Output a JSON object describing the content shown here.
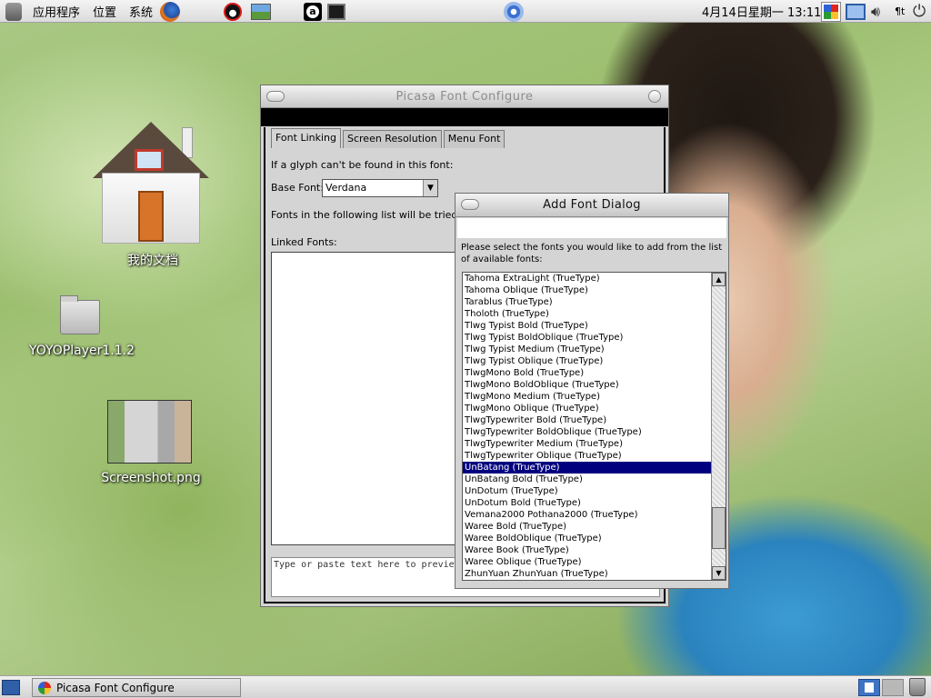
{
  "top_panel": {
    "menus": {
      "applications": "应用程序",
      "places": "位置",
      "system": "系统"
    },
    "clock": "4月14日星期一 13:11",
    "input_indicator": "¶t",
    "icons": [
      "foot-icon",
      "firefox-icon",
      "penguin-icon",
      "photo-icon",
      "a-icon",
      "terminal-icon",
      "network-icon",
      "picasa-icon",
      "monitor-icon",
      "speaker-icon",
      "power-icon"
    ]
  },
  "desktop": {
    "icons": [
      {
        "label": "我的文档",
        "icon": "home-folder-icon"
      },
      {
        "label": "YOYOPlayer1.1.2",
        "icon": "folder-icon"
      },
      {
        "label": "Screenshot.png",
        "icon": "image-thumbnail-icon"
      }
    ]
  },
  "main_window": {
    "title": "Picasa Font Configure",
    "tabs": [
      "Font Linking",
      "Screen Resolution",
      "Menu Font"
    ],
    "active_tab": "Font Linking",
    "glyph_text": "If a glyph can't be found in this font:",
    "base_font_label": "Base Font:",
    "base_font_value": "Verdana",
    "fonts_tried_text": "Fonts in the following list will be tried:",
    "linked_fonts_label": "Linked Fonts:",
    "preview_placeholder": "Type or paste text here to preview"
  },
  "add_font_dialog": {
    "title": "Add Font Dialog",
    "instructions": "Please select the fonts you would like to add from the list of available fonts:",
    "selected": "UnBatang (TrueType)",
    "fonts": [
      "Tahoma ExtraLight (TrueType)",
      "Tahoma Oblique (TrueType)",
      "Tarablus (TrueType)",
      "Tholoth (TrueType)",
      "Tlwg Typist Bold (TrueType)",
      "Tlwg Typist BoldOblique (TrueType)",
      "Tlwg Typist Medium (TrueType)",
      "Tlwg Typist Oblique (TrueType)",
      "TlwgMono Bold (TrueType)",
      "TlwgMono BoldOblique (TrueType)",
      "TlwgMono Medium (TrueType)",
      "TlwgMono Oblique (TrueType)",
      "TlwgTypewriter Bold (TrueType)",
      "TlwgTypewriter BoldOblique (TrueType)",
      "TlwgTypewriter Medium (TrueType)",
      "TlwgTypewriter Oblique (TrueType)",
      "UnBatang (TrueType)",
      "UnBatang Bold (TrueType)",
      "UnDotum (TrueType)",
      "UnDotum Bold (TrueType)",
      "Vemana2000 Pothana2000 (TrueType)",
      "Waree Bold (TrueType)",
      "Waree BoldOblique (TrueType)",
      "Waree Book (TrueType)",
      "Waree Oblique (TrueType)",
      "ZhunYuan ZhunYuan (TrueType)"
    ]
  },
  "taskbar": {
    "tasks": [
      {
        "label": "Picasa Font Configure"
      }
    ]
  },
  "colors": {
    "selection": "#00007f",
    "panel": "#e6e6e6",
    "window_bg": "#d4d4d4"
  }
}
